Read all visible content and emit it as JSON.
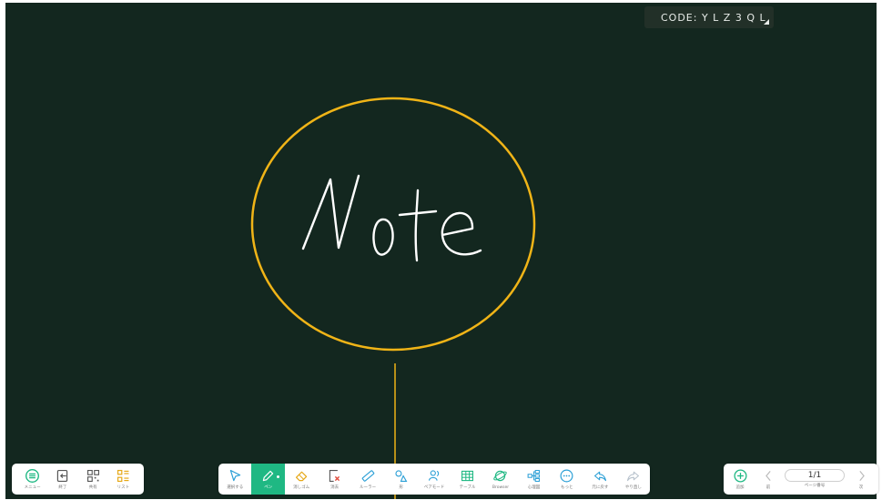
{
  "code_badge": {
    "text": "CODE: Y L Z 3 Q L"
  },
  "canvas": {
    "handwriting": "Note",
    "colors": {
      "background": "#13271f",
      "circle_stroke": "#f0b417",
      "ink": "#ffffff"
    }
  },
  "toolbar_left": {
    "items": [
      {
        "label": "メニュー",
        "icon": "menu-icon"
      },
      {
        "label": "終了",
        "icon": "exit-icon"
      },
      {
        "label": "共有",
        "icon": "qr-code-icon"
      },
      {
        "label": "リスト",
        "icon": "list-icon"
      }
    ]
  },
  "toolbar_center": {
    "items": [
      {
        "label": "選択する",
        "icon": "select-arrow-icon"
      },
      {
        "label": "ペン",
        "icon": "pen-icon",
        "active": true
      },
      {
        "label": "消しゴム",
        "icon": "eraser-icon"
      },
      {
        "label": "消去",
        "icon": "clear-icon"
      },
      {
        "label": "ルーラー",
        "icon": "ruler-icon"
      },
      {
        "label": "形",
        "icon": "shapes-icon"
      },
      {
        "label": "ペアモード",
        "icon": "pair-mode-icon"
      },
      {
        "label": "テーブル",
        "icon": "table-icon"
      },
      {
        "label": "Browser",
        "icon": "browser-icon"
      },
      {
        "label": "心理図",
        "icon": "mind-map-icon"
      },
      {
        "label": "もっと",
        "icon": "more-icon"
      },
      {
        "label": "元に戻す",
        "icon": "undo-icon"
      },
      {
        "label": "やり直し",
        "icon": "redo-icon"
      }
    ]
  },
  "toolbar_right": {
    "add_label": "追加",
    "prev_label": "前",
    "page_value": "1/1",
    "page_label": "ページ番号",
    "next_label": "次"
  },
  "accent_color": "#1fb883"
}
